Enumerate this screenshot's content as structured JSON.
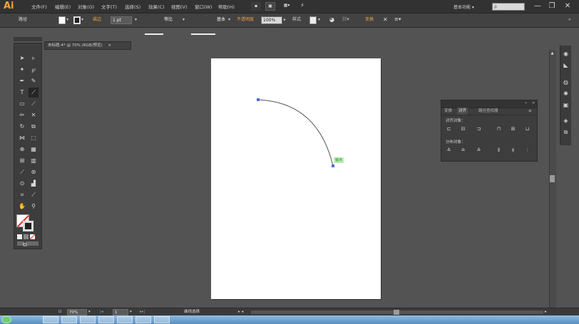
{
  "app": {
    "logo": "Ai"
  },
  "menu": [
    "文件(F)",
    "编辑(E)",
    "对象(O)",
    "文字(T)",
    "选择(S)",
    "效果(C)",
    "视图(V)",
    "窗口(W)",
    "帮助(H)"
  ],
  "menubar_icons": [
    "bridge-icon",
    "arrange-documents-icon",
    "gpu-icon"
  ],
  "workspace": {
    "label": "基本功能 ▾",
    "search_placeholder": "ρ"
  },
  "window_controls": [
    "—",
    "❐",
    "✕"
  ],
  "control": {
    "selection_type": "路径",
    "stroke_label": "描边",
    "stroke_weight": "1 pt",
    "profile_label": "等比",
    "brush_label": "基本",
    "opacity_label": "不透明度",
    "opacity_value": "100%",
    "style_label": "样式",
    "shape_label": "变换"
  },
  "document": {
    "tab_title": "未标题-4* @ 70% (RGB/预览)",
    "close": "×"
  },
  "tools": [
    "selection-tool",
    "direct-selection-tool",
    "magic-wand-tool",
    "lasso-tool",
    "pen-tool",
    "curvature-tool",
    "type-tool",
    "line-tool",
    "rectangle-tool",
    "paintbrush-tool",
    "pencil-tool",
    "eraser-tool",
    "rotate-tool",
    "scale-tool",
    "width-tool",
    "free-transform-tool",
    "shape-builder-tool",
    "perspective-tool",
    "mesh-tool",
    "gradient-tool",
    "eyedropper-tool",
    "blend-tool",
    "symbol-sprayer-tool",
    "column-graph-tool",
    "artboard-tool",
    "slice-tool",
    "hand-tool",
    "zoom-tool"
  ],
  "canvas": {
    "anchor_tooltip": "锚点"
  },
  "align_panel": {
    "tabs": [
      "变换",
      "对齐",
      "路径查找器"
    ],
    "active_tab": "对齐",
    "align_objects_label": "对齐对象：",
    "distribute_objects_label": "分布对象："
  },
  "status": {
    "zoom": "70%",
    "page": "1",
    "tool_name": "曲线选择"
  }
}
